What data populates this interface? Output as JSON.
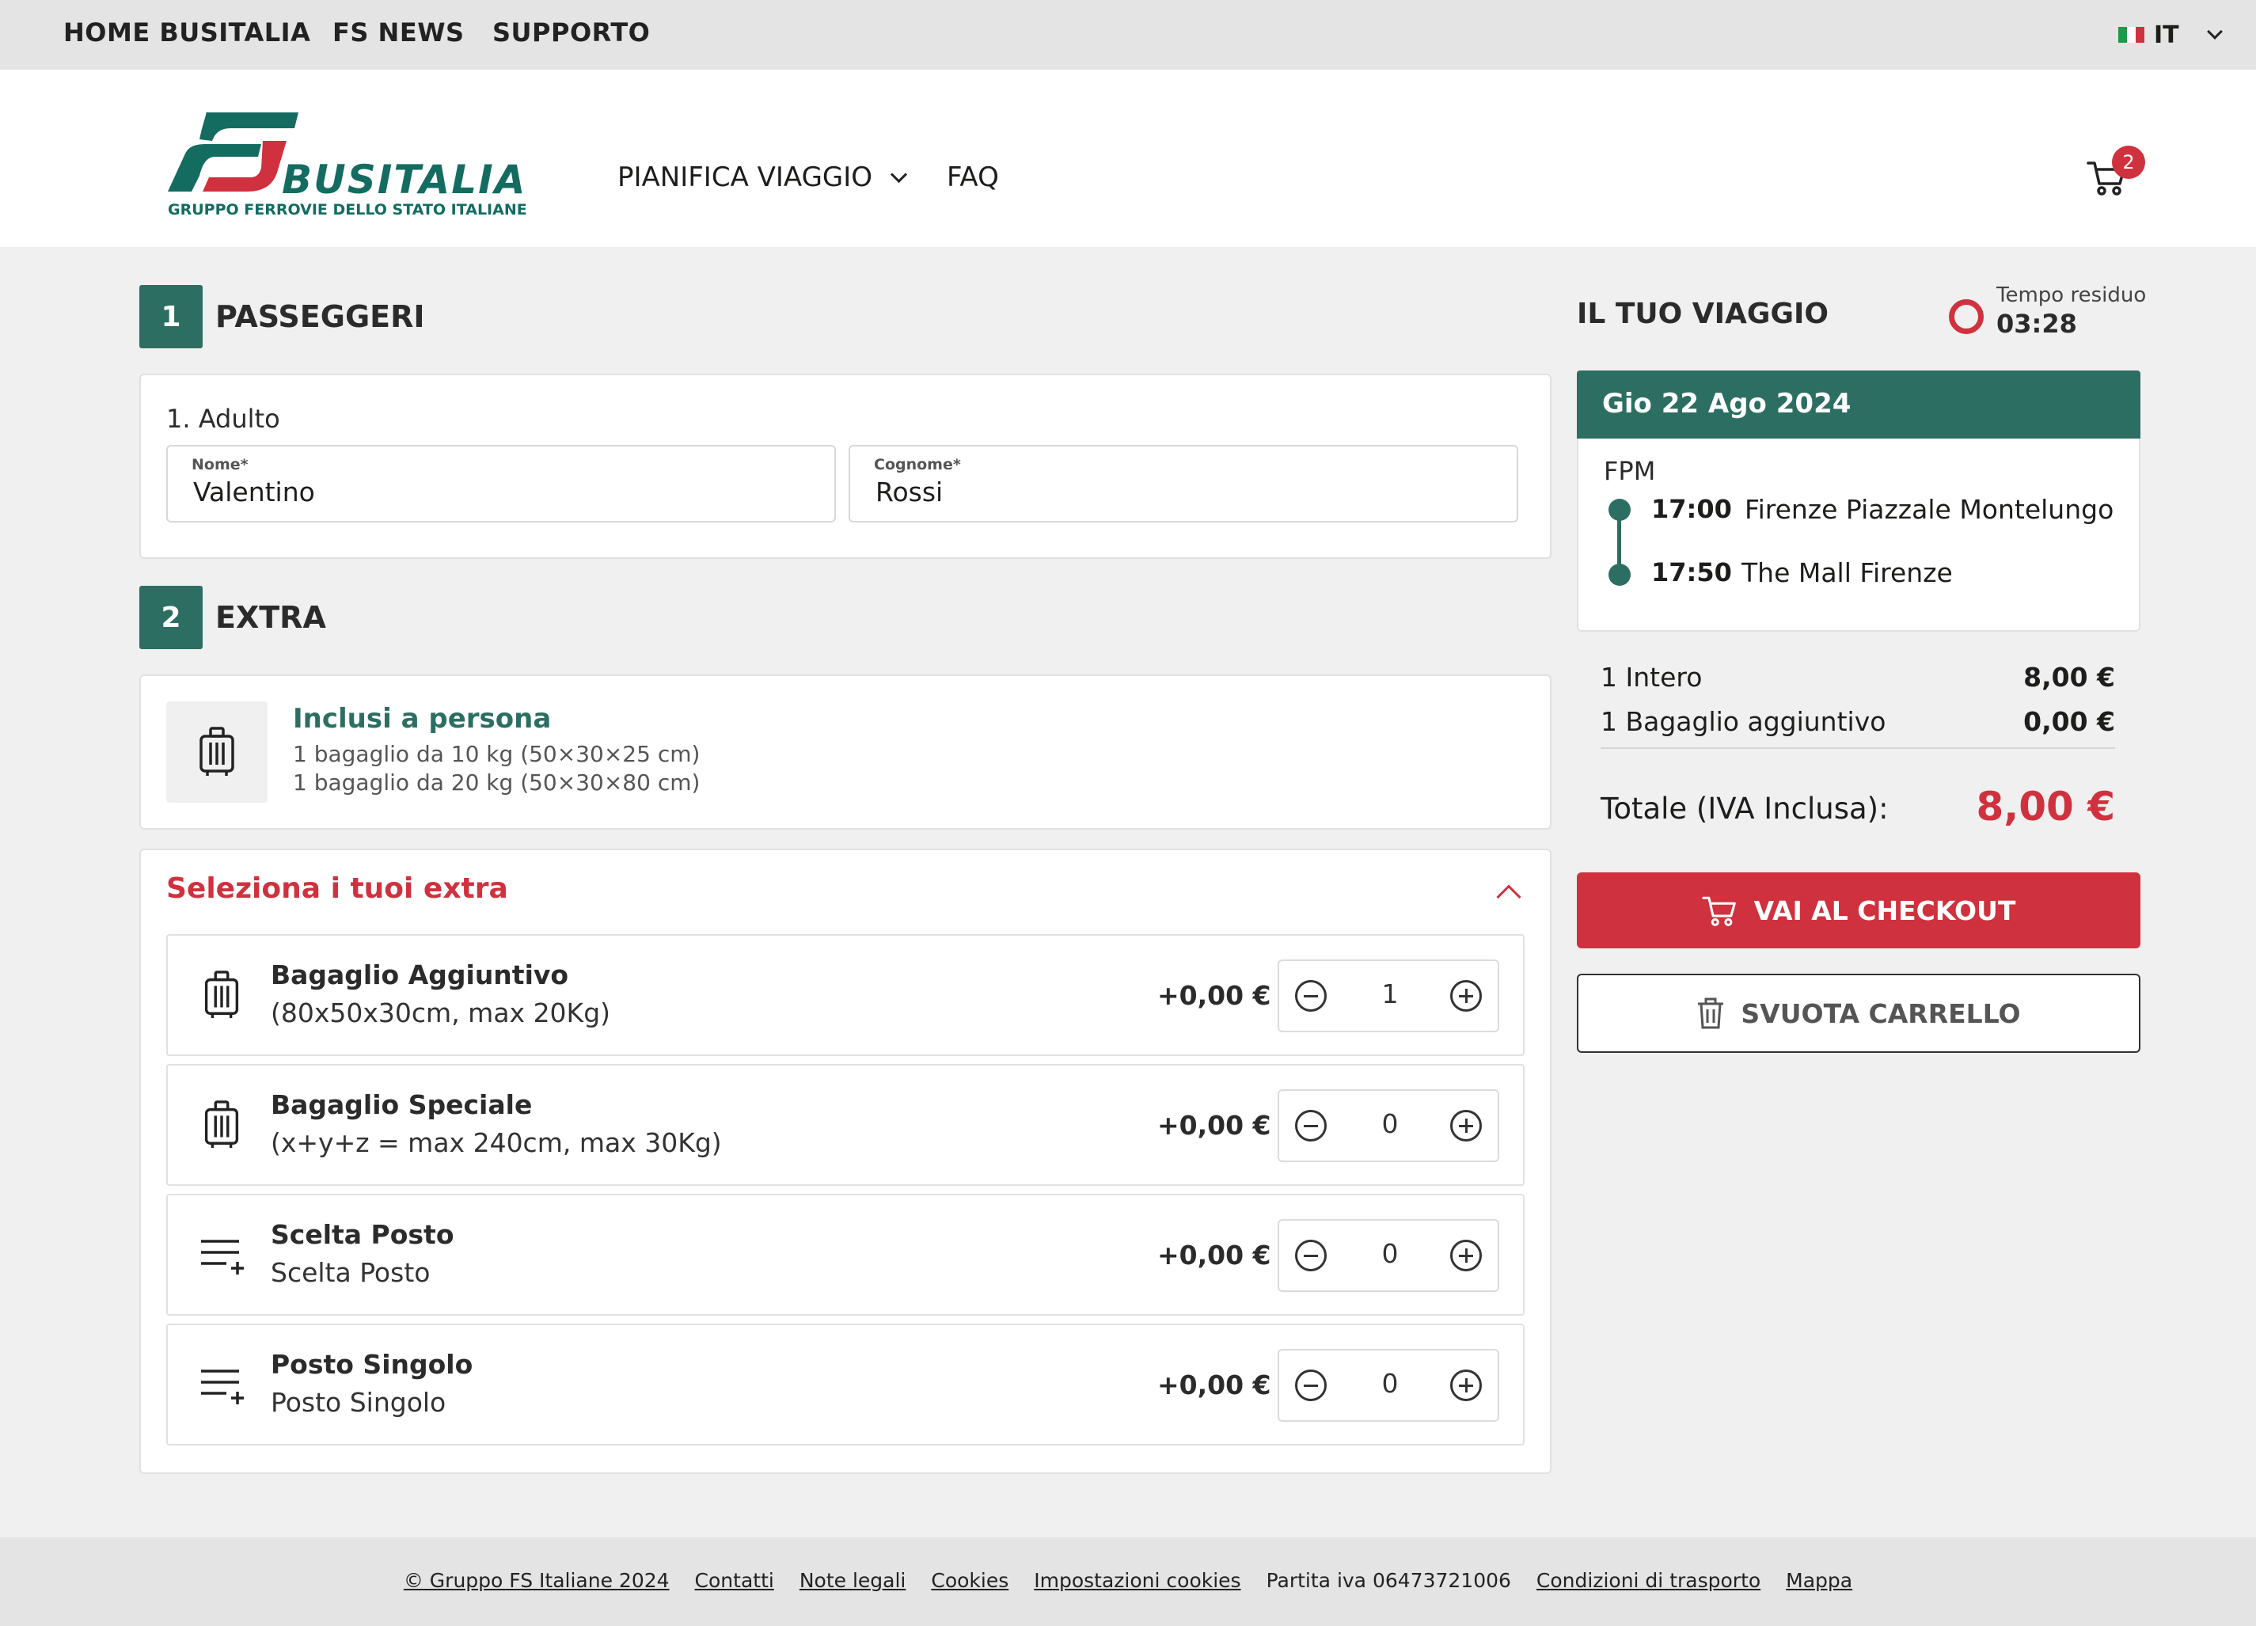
{
  "topbar": {
    "links": [
      "HOME BUSITALIA",
      "FS NEWS",
      "SUPPORTO"
    ],
    "language": "IT"
  },
  "header": {
    "logo_word": "BUSITALIA",
    "logo_tagline": "GRUPPO FERROVIE DELLO STATO ITALIANE",
    "nav_plan": "PIANIFICA VIAGGIO",
    "nav_faq": "FAQ",
    "cart_count": "2"
  },
  "colors": {
    "brand_green": "#2c6e62",
    "accent_red": "#d0313e"
  },
  "passengers": {
    "step": "1",
    "title": "PASSEGGERI",
    "passenger_label": "1. Adulto",
    "name_label": "Nome*",
    "name_value": "Valentino",
    "surname_label": "Cognome*",
    "surname_value": "Rossi"
  },
  "extra": {
    "step": "2",
    "title": "EXTRA",
    "included_title": "Inclusi a persona",
    "included_lines": [
      "1 bagaglio da 10 kg (50×30×25 cm)",
      "1 bagaglio da 20 kg (50×30×80 cm)"
    ],
    "select_title": "Seleziona i tuoi extra",
    "items": [
      {
        "name": "Bagaglio Aggiuntivo",
        "desc": "(80x50x30cm, max 20Kg)",
        "price": "+0,00 €",
        "qty": "1",
        "icon": "luggage-icon"
      },
      {
        "name": "Bagaglio Speciale",
        "desc": "(x+y+z = max 240cm, max 30Kg)",
        "price": "+0,00 €",
        "qty": "0",
        "icon": "luggage-icon"
      },
      {
        "name": "Scelta Posto",
        "desc": "Scelta Posto",
        "price": "+0,00 €",
        "qty": "0",
        "icon": "list-add-icon"
      },
      {
        "name": "Posto Singolo",
        "desc": "Posto Singolo",
        "price": "+0,00 €",
        "qty": "0",
        "icon": "list-add-icon"
      }
    ]
  },
  "trip": {
    "title": "IL TUO VIAGGIO",
    "timer_label": "Tempo residuo",
    "timer_value": "03:28",
    "date": "Gio 22 Ago 2024",
    "company": "FPM",
    "departure_time": "17:00",
    "departure_stop": "Firenze Piazzale Montelungo",
    "arrival_time": "17:50",
    "arrival_stop": "The Mall Firenze"
  },
  "summary": {
    "lines": [
      {
        "label": "1 Intero",
        "amount": "8,00 €"
      },
      {
        "label": "1 Bagaglio aggiuntivo",
        "amount": "0,00 €"
      }
    ],
    "total_label": "Totale (IVA Inclusa):",
    "total_amount": "8,00 €",
    "checkout_label": "VAI AL CHECKOUT",
    "empty_label": "SVUOTA CARRELLO"
  },
  "footer": {
    "copyright": "© Gruppo FS Italiane 2024",
    "contacts": "Contatti",
    "legal": "Note legali",
    "cookies": "Cookies",
    "cookie_settings": "Impostazioni cookies",
    "vat": "Partita iva 06473721006",
    "transport_terms": "Condizioni di trasporto",
    "map": "Mappa"
  }
}
